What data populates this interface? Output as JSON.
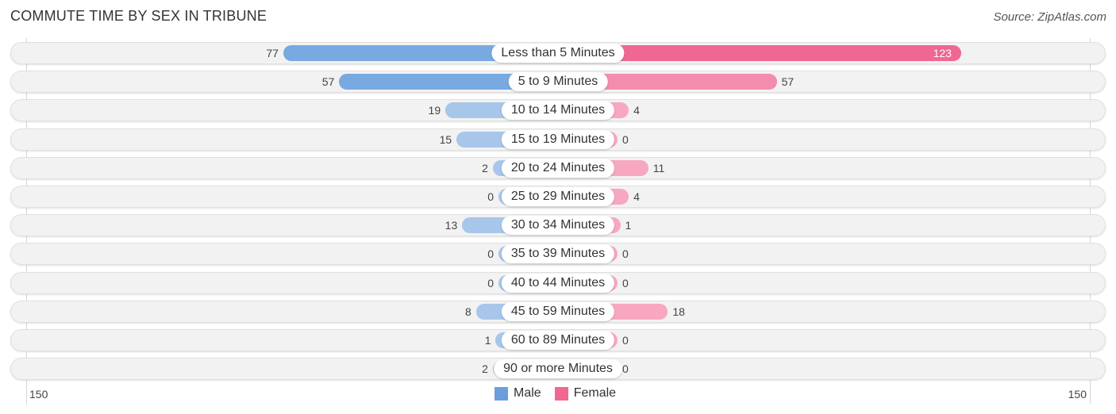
{
  "header": {
    "title": "COMMUTE TIME BY SEX IN TRIBUNE",
    "source": "Source: ZipAtlas.com"
  },
  "colors": {
    "male": "#6a9fdb",
    "female": "#f06891",
    "male_light": "#a7c6ea",
    "female_light": "#f7a8c0"
  },
  "chart_data": {
    "type": "bar",
    "orientation": "horizontal-diverging",
    "title": "COMMUTE TIME BY SEX IN TRIBUNE",
    "categories": [
      "Less than 5 Minutes",
      "5 to 9 Minutes",
      "10 to 14 Minutes",
      "15 to 19 Minutes",
      "20 to 24 Minutes",
      "25 to 29 Minutes",
      "30 to 34 Minutes",
      "35 to 39 Minutes",
      "40 to 44 Minutes",
      "45 to 59 Minutes",
      "60 to 89 Minutes",
      "90 or more Minutes"
    ],
    "series": [
      {
        "name": "Male",
        "values": [
          77,
          57,
          19,
          15,
          2,
          0,
          13,
          0,
          0,
          8,
          1,
          2
        ]
      },
      {
        "name": "Female",
        "values": [
          123,
          57,
          4,
          0,
          11,
          4,
          1,
          0,
          0,
          18,
          0,
          0
        ]
      }
    ],
    "axis_min_label": "150",
    "axis_max_label": "150",
    "xlim": [
      -150,
      150
    ],
    "legend": [
      "Male",
      "Female"
    ],
    "legend_position": "bottom-center",
    "grid": false
  }
}
